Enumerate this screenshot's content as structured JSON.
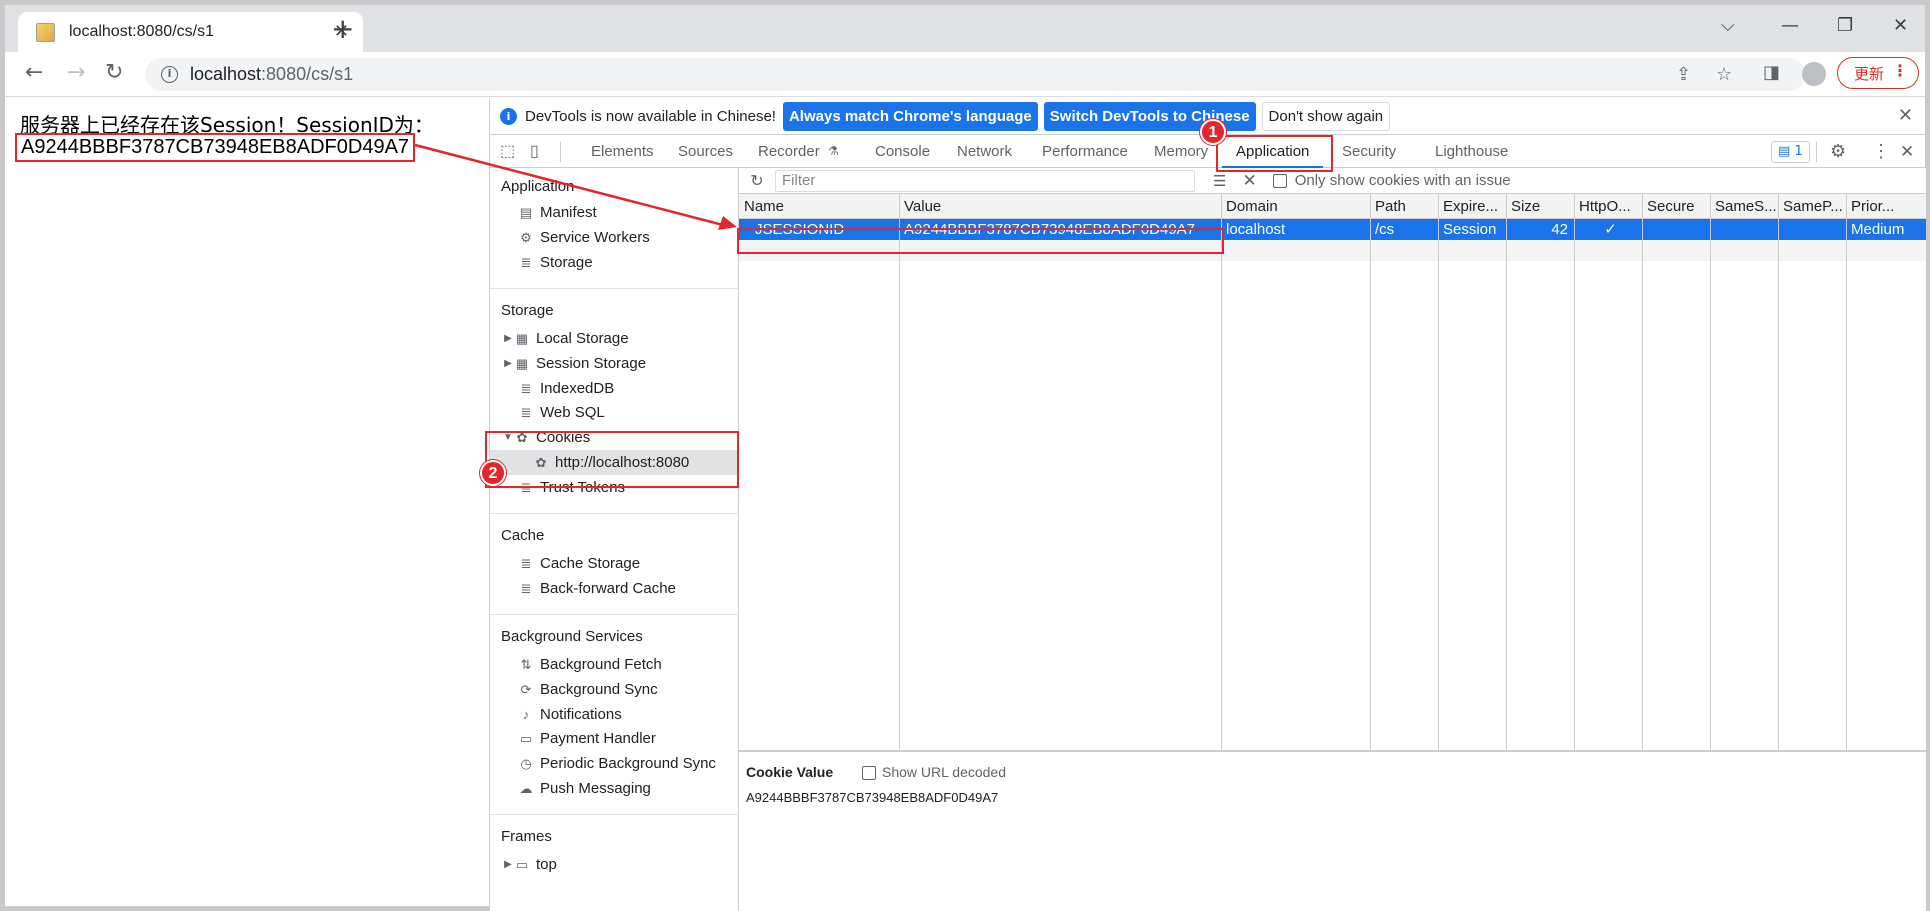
{
  "browser": {
    "tab_title": "localhost:8080/cs/s1",
    "new_tab": "+",
    "url_host": "localhost",
    "url_rest": ":8080/cs/s1",
    "update_label": "更新"
  },
  "page": {
    "line1": "服务器上已经存在该Session！SessionID为：",
    "line2": "A9244BBBF3787CB73948EB8ADF0D49A7"
  },
  "infobar": {
    "message": "DevTools is now available in Chinese!",
    "btn_match": "Always match Chrome's language",
    "btn_switch": "Switch DevTools to Chinese",
    "btn_dismiss": "Don't show again"
  },
  "devtools_tabs": [
    "Elements",
    "Sources",
    "Recorder",
    "Console",
    "Network",
    "Performance",
    "Memory",
    "Application",
    "Security",
    "Lighthouse"
  ],
  "issues_count": "1",
  "sidebar": {
    "application_header": "Application",
    "application_items": [
      "Manifest",
      "Service Workers",
      "Storage"
    ],
    "storage_header": "Storage",
    "storage_items": [
      "Local Storage",
      "Session Storage",
      "IndexedDB",
      "Web SQL",
      "Cookies",
      "http://localhost:8080",
      "Trust Tokens"
    ],
    "cache_header": "Cache",
    "cache_items": [
      "Cache Storage",
      "Back-forward Cache"
    ],
    "bg_header": "Background Services",
    "bg_items": [
      "Background Fetch",
      "Background Sync",
      "Notifications",
      "Payment Handler",
      "Periodic Background Sync",
      "Push Messaging"
    ],
    "frames_header": "Frames",
    "frames_items": [
      "top"
    ]
  },
  "cookies": {
    "filter_placeholder": "Filter",
    "only_issues_label": "Only show cookies with an issue",
    "columns": [
      "Name",
      "Value",
      "Domain",
      "Path",
      "Expire...",
      "Size",
      "HttpO...",
      "Secure",
      "SameS...",
      "SameP...",
      "Prior..."
    ],
    "rows": [
      [
        "JSESSIONID",
        "A9244BBBF3787CB73948EB8ADF0D49A7",
        "localhost",
        "/cs",
        "Session",
        "42",
        "✓",
        "",
        "",
        "",
        "Medium"
      ]
    ],
    "value_panel_title": "Cookie Value",
    "show_url_decoded": "Show URL decoded",
    "value_panel_value": "A9244BBBF3787CB73948EB8ADF0D49A7"
  },
  "annotations": {
    "badge1": "1",
    "badge2": "2"
  },
  "colors": {
    "accent": "#1a73e8",
    "annotation": "#e3262b"
  }
}
